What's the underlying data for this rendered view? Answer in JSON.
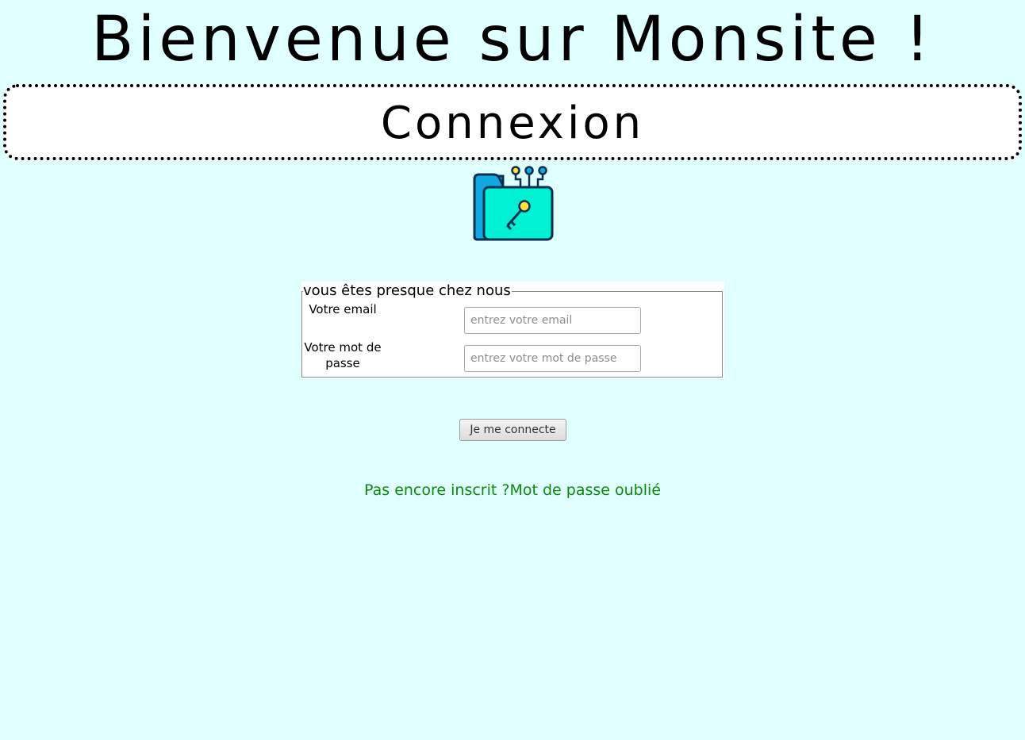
{
  "header": {
    "site_title": "Bienvenue sur Monsite !",
    "section_title": "Connexion"
  },
  "icon": {
    "name": "folder-key-icon",
    "colors": {
      "folder_back": "#11a8e4",
      "folder_front": "#00f0d4",
      "outline": "#0b2f4f",
      "key": "#ffe23b"
    }
  },
  "form": {
    "legend": "vous êtes presque chez nous",
    "email": {
      "label": "Votre email",
      "placeholder": "entrez votre email",
      "value": ""
    },
    "password": {
      "label": "Votre mot de passe",
      "placeholder": "entrez votre mot de passe",
      "value": ""
    },
    "submit_label": "Je me connecte"
  },
  "links": {
    "register": "Pas encore inscrit ?",
    "forgot_password": "Mot de passe oublié",
    "color": "#0a8a0a"
  },
  "theme": {
    "background": "#e0ffff"
  }
}
